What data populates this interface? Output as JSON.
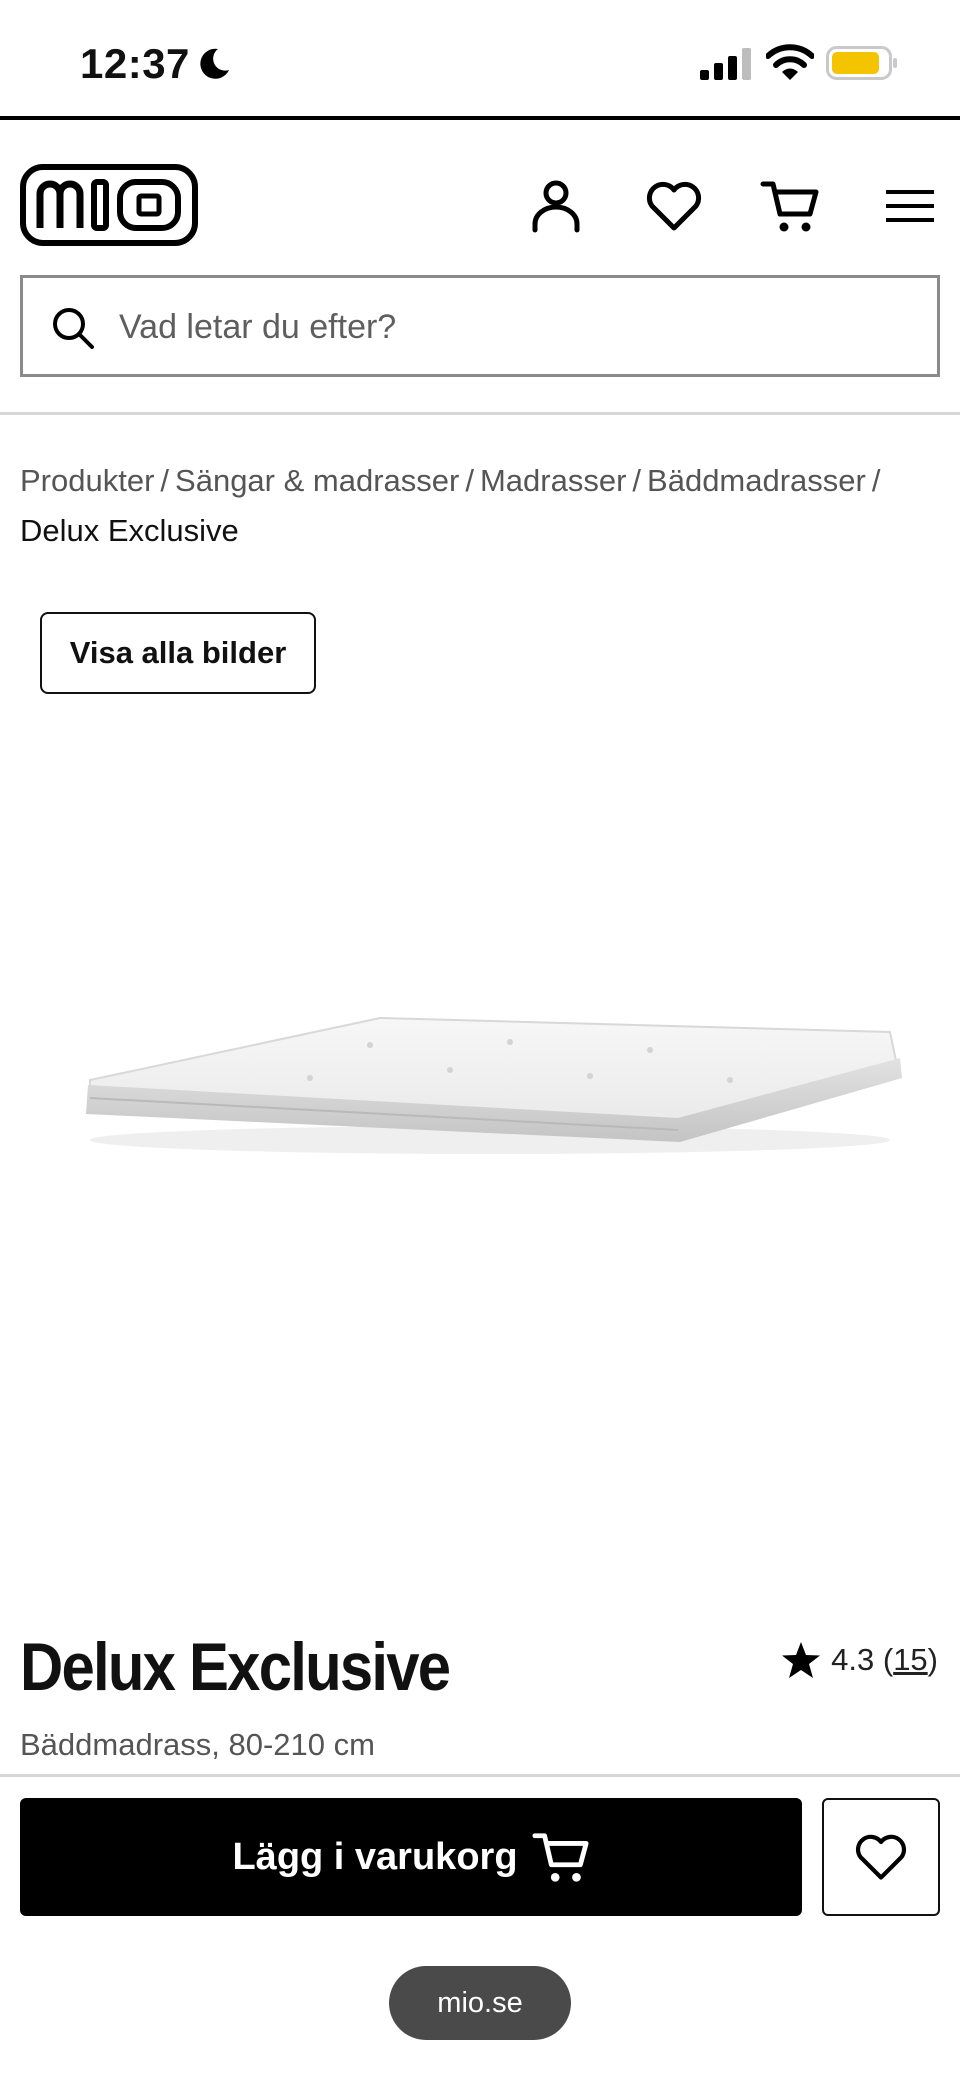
{
  "status_bar": {
    "time": "12:37"
  },
  "header": {
    "logo_text": "mio",
    "icons": {
      "account": "user-icon",
      "wishlist": "heart-icon",
      "cart": "cart-icon",
      "menu": "menu-icon"
    }
  },
  "search": {
    "placeholder": "Vad letar du efter?",
    "value": ""
  },
  "breadcrumb": {
    "items": [
      "Produkter",
      "Sängar & madrasser",
      "Madrasser",
      "Bäddmadrasser"
    ],
    "current": "Delux Exclusive",
    "separator": "/"
  },
  "gallery": {
    "view_all_label": "Visa alla bilder"
  },
  "product": {
    "title": "Delux Exclusive",
    "subtitle": "Bäddmadrass, 80-210 cm",
    "rating_value": "4.3",
    "review_count": "15"
  },
  "actions": {
    "add_to_cart_label": "Lägg i varukorg"
  },
  "browser": {
    "url": "mio.se"
  },
  "colors": {
    "battery": "#f5c400",
    "primary_button": "#000000",
    "divider": "#d6d6d6"
  }
}
